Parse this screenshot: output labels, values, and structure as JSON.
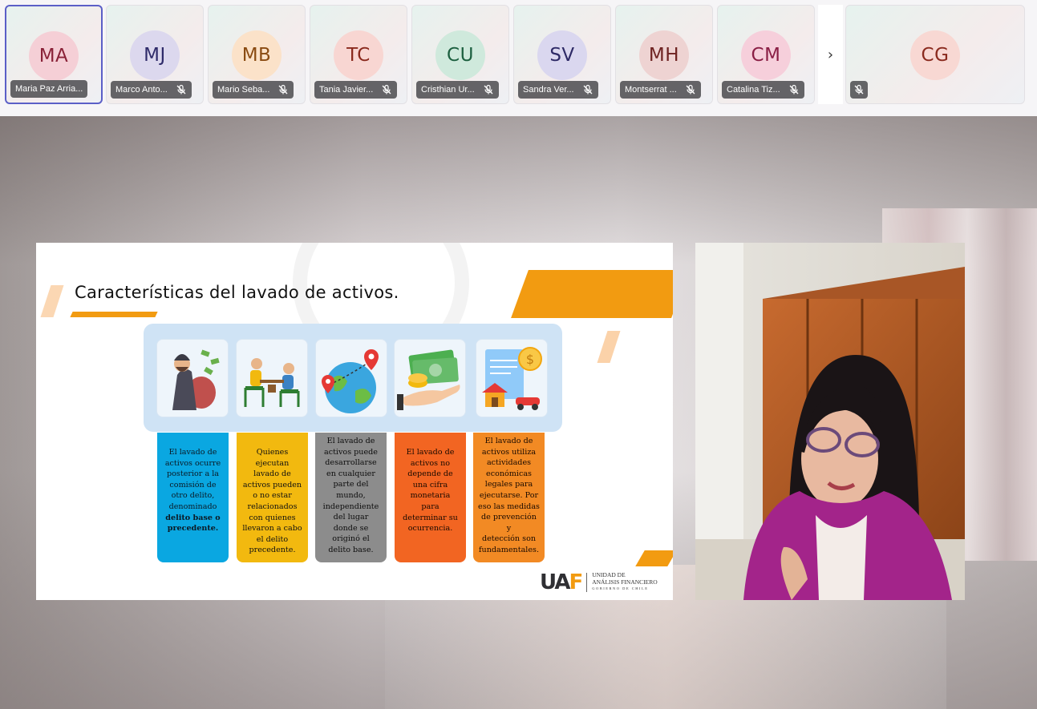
{
  "participants": [
    {
      "initials": "MA",
      "name": "Maria Paz Arria...",
      "avatar_bg": "#f5cfd6",
      "avatar_fg": "#8a2238"
    },
    {
      "initials": "MJ",
      "name": "Marco Anto...",
      "avatar_bg": "#dcd8ee",
      "avatar_fg": "#2f2b6a"
    },
    {
      "initials": "MB",
      "name": "Mario Seba...",
      "avatar_bg": "#fbe2c9",
      "avatar_fg": "#8a4b12"
    },
    {
      "initials": "TC",
      "name": "Tania Javier...",
      "avatar_bg": "#f8d6d2",
      "avatar_fg": "#8a2a1e"
    },
    {
      "initials": "CU",
      "name": "Cristhian Ur...",
      "avatar_bg": "#cfe9dc",
      "avatar_fg": "#1d6040"
    },
    {
      "initials": "SV",
      "name": "Sandra Ver...",
      "avatar_bg": "#dad7ef",
      "avatar_fg": "#2e2a66"
    },
    {
      "initials": "MH",
      "name": "Montserrat ...",
      "avatar_bg": "#eed3d2",
      "avatar_fg": "#6e2322"
    },
    {
      "initials": "CM",
      "name": "Catalina Tiz...",
      "avatar_bg": "#f6cfdb",
      "avatar_fg": "#8a1f45"
    }
  ],
  "more_arrow": "›",
  "featured_participant": {
    "initials": "CG",
    "name": "",
    "avatar_bg": "#f8d8d3",
    "avatar_fg": "#8a2a1e"
  },
  "slide": {
    "title": "Características del lavado de activos.",
    "columns": [
      {
        "lines": [
          "El lavado de",
          "activos ocurre",
          "posterior a la",
          "comisión de",
          "otro delito,",
          "denominado"
        ],
        "bold": [
          "delito base o",
          "precedente."
        ],
        "color": "#0aa7e1"
      },
      {
        "lines": [
          "Quienes",
          "ejecutan",
          "lavado de",
          "activos pueden",
          "o no estar",
          "relacionados",
          "con quienes",
          "llevaron a cabo",
          "el delito",
          "precedente."
        ],
        "bold": [],
        "color": "#f2b90f"
      },
      {
        "lines": [
          "El lavado de",
          "activos puede",
          "desarrollarse",
          "en cualquier",
          "parte del",
          "mundo,",
          "independiente",
          "del lugar",
          "donde se",
          "originó el",
          "delito base."
        ],
        "bold": [],
        "color": "#8c8c8c"
      },
      {
        "lines": [
          "El lavado de",
          "activos no",
          "depende de",
          "una cifra",
          "monetaria",
          "para",
          "determinar su",
          "ocurrencia."
        ],
        "bold": [],
        "color": "#f26522"
      },
      {
        "lines": [
          "El lavado de",
          "activos utiliza",
          "actividades",
          "económicas",
          "legales para",
          "ejecutarse.  Por",
          "eso las medidas",
          "de prevención y",
          "detección son",
          "fundamentales."
        ],
        "bold": [],
        "color": "#f28a24"
      }
    ],
    "icons": [
      "thief-with-money-bag-icon",
      "meeting-people-table-icon",
      "globe-location-pins-icon",
      "hand-with-money-coins-icon",
      "document-house-car-coin-icon"
    ],
    "logo": {
      "mark_left": "UA",
      "mark_right": "F",
      "line1": "UNIDAD DE",
      "line2": "ANÁLISIS FINANCIERO",
      "line3": "GOBIERNO DE CHILE"
    }
  }
}
